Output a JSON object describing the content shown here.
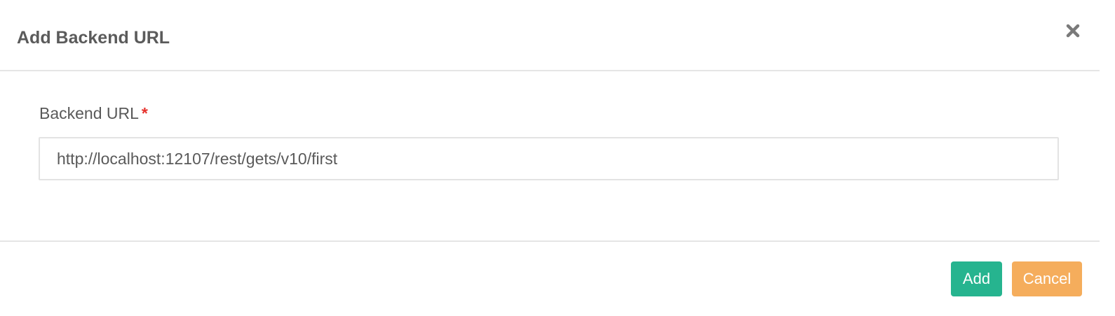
{
  "dialog": {
    "title": "Add Backend URL",
    "close_icon": "close-icon"
  },
  "form": {
    "label": "Backend URL",
    "required_mark": "*",
    "url_value": "http://localhost:12107/rest/gets/v10/first"
  },
  "footer": {
    "add_label": "Add",
    "cancel_label": "Cancel"
  },
  "colors": {
    "primary": "#26b48f",
    "warning": "#f5ad5c",
    "required": "#e6322d"
  }
}
